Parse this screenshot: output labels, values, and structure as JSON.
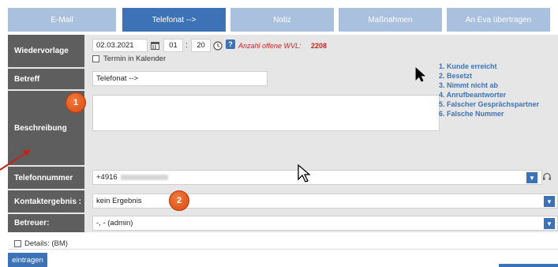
{
  "tabs": [
    {
      "label": "E-Mail",
      "active": false
    },
    {
      "label": "Telefonat -->",
      "active": true
    },
    {
      "label": "Notiz",
      "active": false
    },
    {
      "label": "Maßnahmen",
      "active": false
    },
    {
      "label": "An Eva übertragen",
      "active": false
    }
  ],
  "wiedervorlage": {
    "label": "Wiedervorlage",
    "date": "02.03.2021",
    "hour": "01",
    "minute": "20",
    "time_sep": ":",
    "termin_label": "Termin in Kalender",
    "anzahl_text": "Anzahl offene WVL:",
    "anzahl_value": "2208"
  },
  "betreff": {
    "label": "Betreff",
    "value": "Telefonat -->"
  },
  "beschreibung": {
    "label": "Beschreibung",
    "value": "",
    "options": [
      "1. Kunde erreicht",
      "2. Besetzt",
      "3. Nimmt nicht ab",
      "4. Anrufbeantworter",
      "5. Falscher Gesprächspartner",
      "6. Falsche Nummer"
    ]
  },
  "telefonnummer": {
    "label": "Telefonnummer",
    "value": "+4916"
  },
  "kontaktergebnis": {
    "label": "Kontaktergebnis :",
    "value": "kein Ergebnis"
  },
  "betreuer": {
    "label": "Betreuer:",
    "value": "-, - (admin)"
  },
  "details": {
    "label": "Details: (BM)"
  },
  "submit_label": "eintragen",
  "annotations": [
    "1",
    "2"
  ],
  "colors": {
    "accent": "#3d73b6",
    "tab_inactive": "#a9c1de",
    "label_bg": "#5e5e5e",
    "badge": "#e0561a",
    "alert_red": "#cc2222"
  }
}
